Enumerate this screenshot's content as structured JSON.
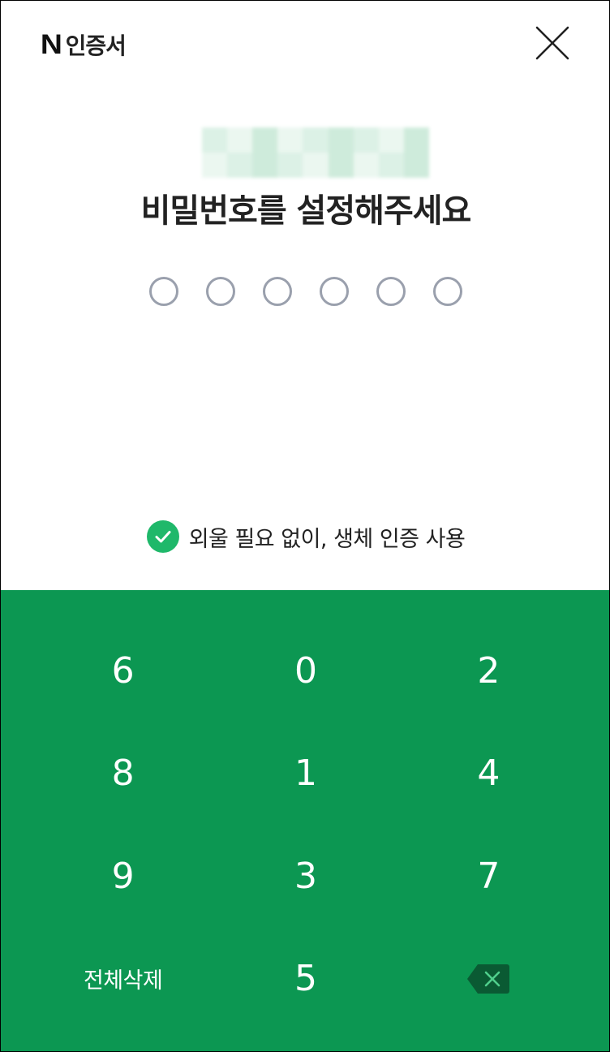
{
  "header": {
    "brand_mark": "N",
    "brand_text": "인증서"
  },
  "title": "비밀번호를 설정해주세요",
  "pin": {
    "length": 6,
    "filled": 0
  },
  "biometric": {
    "label": "외울 필요 없이, 생체 인증 사용",
    "checked": true
  },
  "keypad": {
    "rows": [
      [
        "6",
        "0",
        "2"
      ],
      [
        "8",
        "1",
        "4"
      ],
      [
        "9",
        "3",
        "7"
      ]
    ],
    "clear_label": "전체삭제",
    "last_digit": "5",
    "backspace_icon": "backspace-icon"
  },
  "colors": {
    "keypad_bg": "#0c9752",
    "check_green": "#1fb86a",
    "dot_border": "#9aa0ad"
  }
}
